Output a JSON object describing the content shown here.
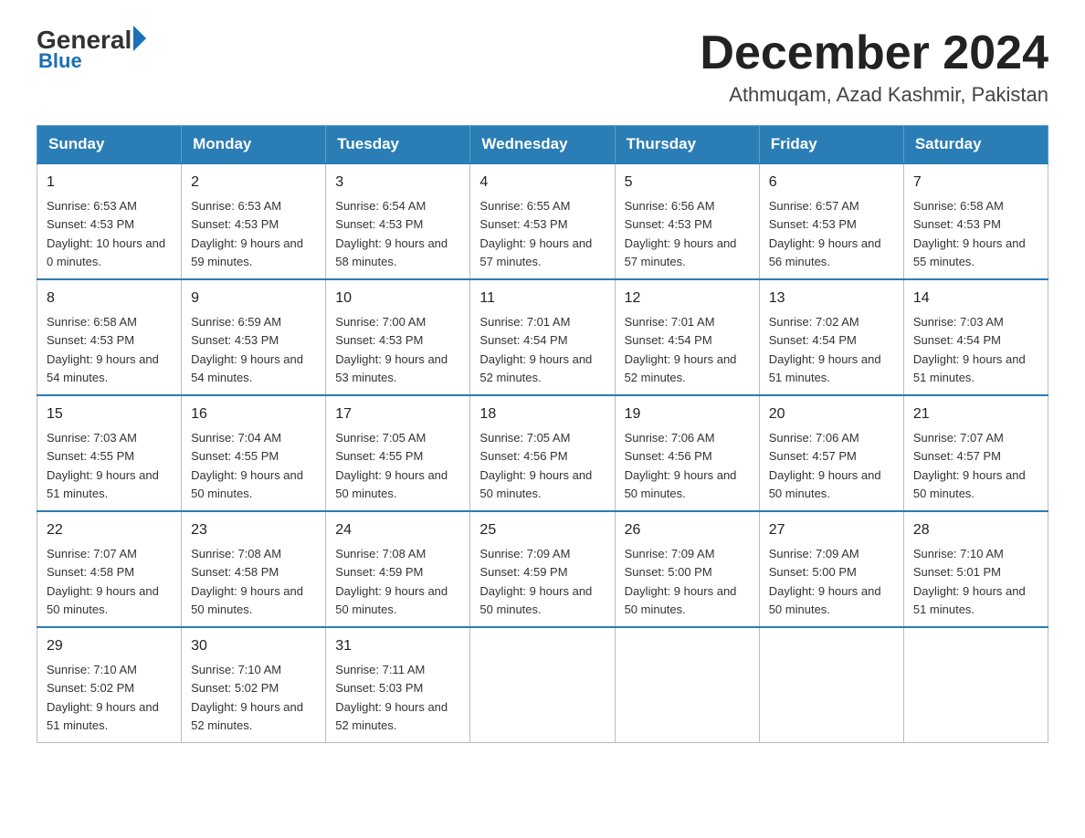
{
  "header": {
    "logo_text_general": "General",
    "logo_text_blue": "Blue",
    "month_title": "December 2024",
    "subtitle": "Athmuqam, Azad Kashmir, Pakistan"
  },
  "days_of_week": [
    "Sunday",
    "Monday",
    "Tuesday",
    "Wednesday",
    "Thursday",
    "Friday",
    "Saturday"
  ],
  "weeks": [
    [
      {
        "day": "1",
        "sunrise": "6:53 AM",
        "sunset": "4:53 PM",
        "daylight": "10 hours and 0 minutes."
      },
      {
        "day": "2",
        "sunrise": "6:53 AM",
        "sunset": "4:53 PM",
        "daylight": "9 hours and 59 minutes."
      },
      {
        "day": "3",
        "sunrise": "6:54 AM",
        "sunset": "4:53 PM",
        "daylight": "9 hours and 58 minutes."
      },
      {
        "day": "4",
        "sunrise": "6:55 AM",
        "sunset": "4:53 PM",
        "daylight": "9 hours and 57 minutes."
      },
      {
        "day": "5",
        "sunrise": "6:56 AM",
        "sunset": "4:53 PM",
        "daylight": "9 hours and 57 minutes."
      },
      {
        "day": "6",
        "sunrise": "6:57 AM",
        "sunset": "4:53 PM",
        "daylight": "9 hours and 56 minutes."
      },
      {
        "day": "7",
        "sunrise": "6:58 AM",
        "sunset": "4:53 PM",
        "daylight": "9 hours and 55 minutes."
      }
    ],
    [
      {
        "day": "8",
        "sunrise": "6:58 AM",
        "sunset": "4:53 PM",
        "daylight": "9 hours and 54 minutes."
      },
      {
        "day": "9",
        "sunrise": "6:59 AM",
        "sunset": "4:53 PM",
        "daylight": "9 hours and 54 minutes."
      },
      {
        "day": "10",
        "sunrise": "7:00 AM",
        "sunset": "4:53 PM",
        "daylight": "9 hours and 53 minutes."
      },
      {
        "day": "11",
        "sunrise": "7:01 AM",
        "sunset": "4:54 PM",
        "daylight": "9 hours and 52 minutes."
      },
      {
        "day": "12",
        "sunrise": "7:01 AM",
        "sunset": "4:54 PM",
        "daylight": "9 hours and 52 minutes."
      },
      {
        "day": "13",
        "sunrise": "7:02 AM",
        "sunset": "4:54 PM",
        "daylight": "9 hours and 51 minutes."
      },
      {
        "day": "14",
        "sunrise": "7:03 AM",
        "sunset": "4:54 PM",
        "daylight": "9 hours and 51 minutes."
      }
    ],
    [
      {
        "day": "15",
        "sunrise": "7:03 AM",
        "sunset": "4:55 PM",
        "daylight": "9 hours and 51 minutes."
      },
      {
        "day": "16",
        "sunrise": "7:04 AM",
        "sunset": "4:55 PM",
        "daylight": "9 hours and 50 minutes."
      },
      {
        "day": "17",
        "sunrise": "7:05 AM",
        "sunset": "4:55 PM",
        "daylight": "9 hours and 50 minutes."
      },
      {
        "day": "18",
        "sunrise": "7:05 AM",
        "sunset": "4:56 PM",
        "daylight": "9 hours and 50 minutes."
      },
      {
        "day": "19",
        "sunrise": "7:06 AM",
        "sunset": "4:56 PM",
        "daylight": "9 hours and 50 minutes."
      },
      {
        "day": "20",
        "sunrise": "7:06 AM",
        "sunset": "4:57 PM",
        "daylight": "9 hours and 50 minutes."
      },
      {
        "day": "21",
        "sunrise": "7:07 AM",
        "sunset": "4:57 PM",
        "daylight": "9 hours and 50 minutes."
      }
    ],
    [
      {
        "day": "22",
        "sunrise": "7:07 AM",
        "sunset": "4:58 PM",
        "daylight": "9 hours and 50 minutes."
      },
      {
        "day": "23",
        "sunrise": "7:08 AM",
        "sunset": "4:58 PM",
        "daylight": "9 hours and 50 minutes."
      },
      {
        "day": "24",
        "sunrise": "7:08 AM",
        "sunset": "4:59 PM",
        "daylight": "9 hours and 50 minutes."
      },
      {
        "day": "25",
        "sunrise": "7:09 AM",
        "sunset": "4:59 PM",
        "daylight": "9 hours and 50 minutes."
      },
      {
        "day": "26",
        "sunrise": "7:09 AM",
        "sunset": "5:00 PM",
        "daylight": "9 hours and 50 minutes."
      },
      {
        "day": "27",
        "sunrise": "7:09 AM",
        "sunset": "5:00 PM",
        "daylight": "9 hours and 50 minutes."
      },
      {
        "day": "28",
        "sunrise": "7:10 AM",
        "sunset": "5:01 PM",
        "daylight": "9 hours and 51 minutes."
      }
    ],
    [
      {
        "day": "29",
        "sunrise": "7:10 AM",
        "sunset": "5:02 PM",
        "daylight": "9 hours and 51 minutes."
      },
      {
        "day": "30",
        "sunrise": "7:10 AM",
        "sunset": "5:02 PM",
        "daylight": "9 hours and 52 minutes."
      },
      {
        "day": "31",
        "sunrise": "7:11 AM",
        "sunset": "5:03 PM",
        "daylight": "9 hours and 52 minutes."
      },
      null,
      null,
      null,
      null
    ]
  ]
}
